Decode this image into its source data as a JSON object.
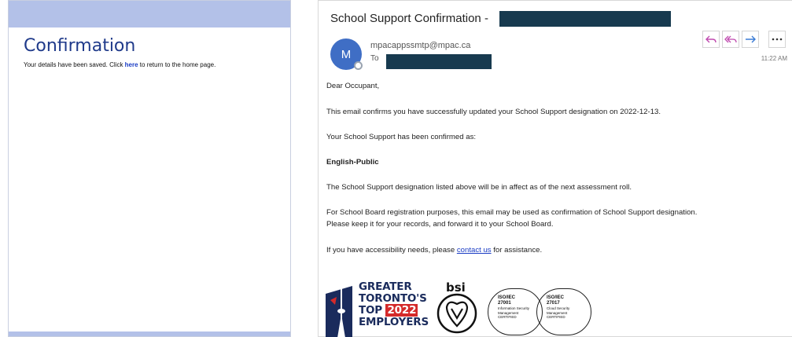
{
  "confirmation_page": {
    "title": "Confirmation",
    "message_prefix": "Your details have been saved. Click ",
    "link_text": "here",
    "message_suffix": " to return to the home page."
  },
  "email": {
    "subject": "School Support Confirmation - ",
    "avatar_initial": "M",
    "sender": "mpacappssmtp@mpac.ca",
    "to_label": "To",
    "time": "11:22 AM",
    "actions": {
      "reply_icon": "reply-icon",
      "reply_all_icon": "reply-all-icon",
      "forward_icon": "forward-icon",
      "more_icon": "more-icon"
    },
    "body": {
      "greeting": "Dear Occupant,",
      "line1": "This email confirms you have successfully updated your School Support designation on 2022-12-13.",
      "line2": "Your School Support has been confirmed as:",
      "designation": "English-Public",
      "line3": "The School Support designation listed above will be in affect as of the next assessment roll.",
      "line4a": "For School Board registration purposes, this email may be used as confirmation of School Support designation.",
      "line4b": "Please keep it for your records, and forward it to your School Board.",
      "line5_prefix": "If you have accessibility needs, please ",
      "line5_link": "contact us",
      "line5_suffix": " for assistance."
    },
    "logos": {
      "gt_line1": "GREATER",
      "gt_line2": "TORONTO'S",
      "gt_line3a": "TOP ",
      "gt_year": "2022",
      "gt_line4": "EMPLOYERS",
      "bsi": "bsi",
      "cert1": {
        "title": "ISO/IEC",
        "number": "27001",
        "line1": "Information Security",
        "line2": "Management",
        "line3": "CERTIFIED"
      },
      "cert2": {
        "title": "ISO/IEC",
        "number": "27017",
        "line1": "Cloud Security",
        "line2": "Management",
        "line3": "CERTIFIED"
      }
    }
  },
  "colors": {
    "header_bar": "#b3c1e8",
    "title_blue": "#1f3a8a",
    "link_blue": "#1a3cc4",
    "redaction": "#173a4f",
    "avatar": "#3f6ec5"
  }
}
